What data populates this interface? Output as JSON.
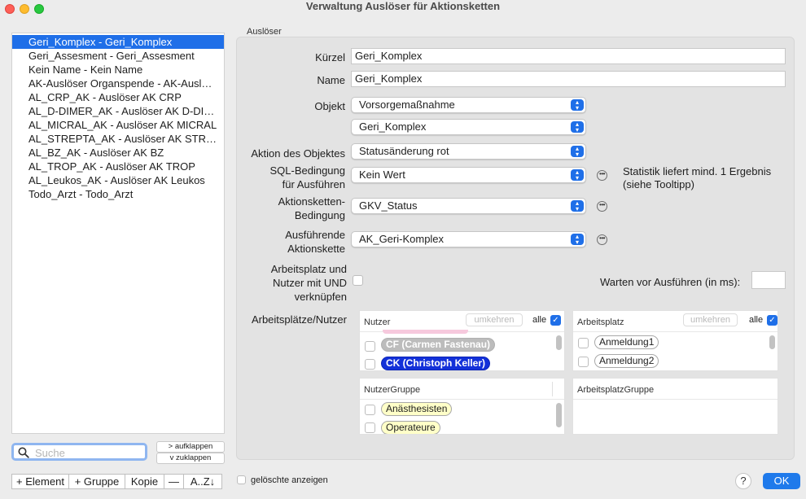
{
  "window": {
    "title": "Verwaltung Auslöser für Aktionsketten"
  },
  "list": {
    "items": [
      "Geri_Komplex - Geri_Komplex",
      "Geri_Assesment - Geri_Assesment",
      "Kein Name - Kein Name",
      "AK-Auslöser Organspende - AK-Ausl…",
      "AL_CRP_AK - Auslöser AK CRP",
      "AL_D-DIMER_AK - Auslöser AK D-DI…",
      "AL_MICRAL_AK - Auslöser AK MICRAL",
      "AL_STREPTA_AK - Auslöser AK STR…",
      "AL_BZ_AK - Auslöser AK BZ",
      "AL_TROP_AK - Auslöser AK TROP",
      "AL_Leukos_AK - Auslöser AK Leukos",
      "Todo_Arzt - Todo_Arzt"
    ],
    "selected_index": 0
  },
  "search": {
    "placeholder": "Suche"
  },
  "expand": {
    "expand_label": "> aufklappen",
    "collapse_label": "v  zuklappen"
  },
  "toolbar": {
    "add_element": "+ Element",
    "add_group": "+ Gruppe",
    "copy": "Kopie",
    "remove": "—",
    "sort": "A..Z↓"
  },
  "footer": {
    "show_deleted_label": "gelöschte anzeigen",
    "help": "?",
    "ok": "OK"
  },
  "form": {
    "section": "Auslöser",
    "kuerzel_label": "Kürzel",
    "kuerzel_value": "Geri_Komplex",
    "name_label": "Name",
    "name_value": "Geri_Komplex",
    "objekt_label": "Objekt",
    "objekt_value": "Vorsorgemaßnahme",
    "objekt_sub_value": "Geri_Komplex",
    "aktion_label": "Aktion des Objektes",
    "aktion_value": "Statusänderung rot",
    "sql_label_1": "SQL-Bedingung",
    "sql_label_2": "für Ausführen",
    "sql_value": "Kein Wert",
    "sql_hint_1": "Statistik liefert mind. 1 Ergebnis",
    "sql_hint_2": "(siehe Tooltipp)",
    "ak_bed_label_1": "Aktionsketten-",
    "ak_bed_label_2": "Bedingung",
    "ak_bed_value": "GKV_Status",
    "ausf_label_1": "Ausführende",
    "ausf_label_2": "Aktionskette",
    "ausf_value": "AK_Geri-Komplex",
    "und_label_1": "Arbeitsplatz und",
    "und_label_2": "Nutzer mit UND",
    "und_label_3": "verknüpfen",
    "und_checked": false,
    "wait_label": "Warten vor Ausführen (in ms):",
    "wait_value": "",
    "workplaces_label": "Arbeitsplätze/Nutzer"
  },
  "panels": {
    "nutzer": {
      "title": "Nutzer",
      "reverse": "umkehren",
      "all": "alle",
      "all_checked": true,
      "items": [
        {
          "label": "CF (Carmen Fastenau)",
          "checked": false,
          "style": "gray"
        },
        {
          "label": "CK (Christoph Keller)",
          "checked": false,
          "style": "blue"
        }
      ]
    },
    "arbeitsplatz": {
      "title": "Arbeitsplatz",
      "reverse": "umkehren",
      "all": "alle",
      "all_checked": true,
      "items": [
        {
          "label": "Anmeldung1",
          "checked": false
        },
        {
          "label": "Anmeldung2",
          "checked": false
        }
      ]
    },
    "nutzergruppe": {
      "title": "NutzerGruppe",
      "items": [
        {
          "label": "Anästhesisten",
          "checked": false
        },
        {
          "label": "Operateure",
          "checked": false
        }
      ]
    },
    "arbeitsplatzgruppe": {
      "title": "ArbeitsplatzGruppe"
    }
  },
  "colors": {
    "accent": "#1f6fe8",
    "selection": "#1f6fe8",
    "user_blue_tag": "#1331d9"
  }
}
